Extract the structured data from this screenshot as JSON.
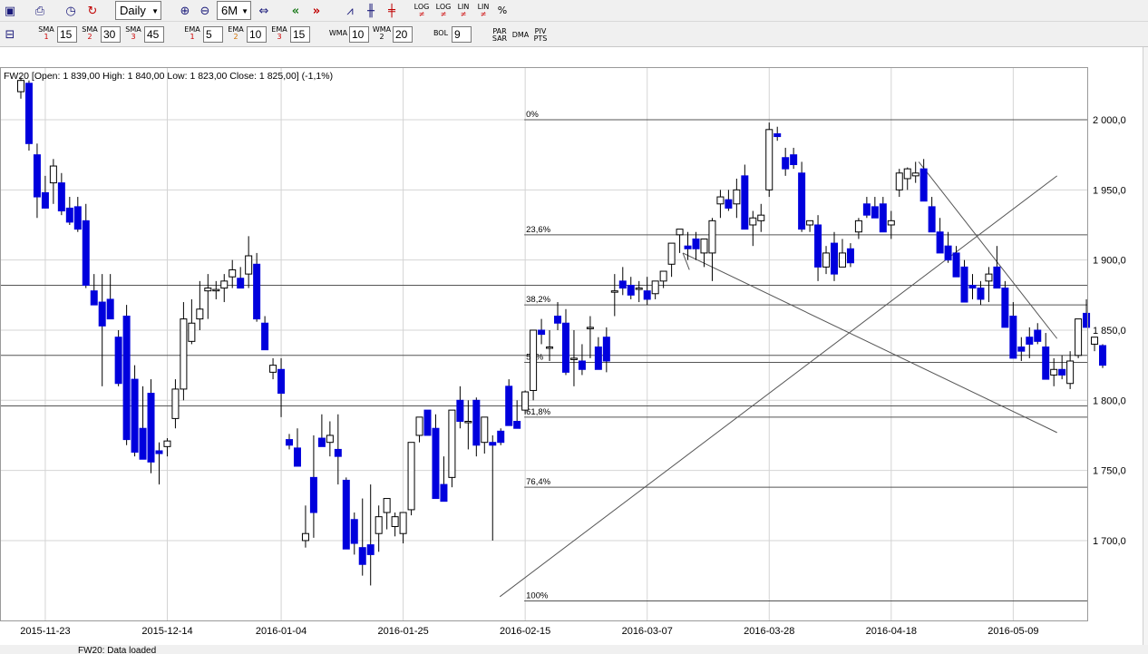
{
  "toolbar": {
    "period_select": "Daily",
    "range_select": "6M",
    "scale_buttons": [
      {
        "top": "LOG",
        "bottom": "≠"
      },
      {
        "top": "LOG",
        "bottom": "≠"
      },
      {
        "top": "LIN",
        "bottom": "≠"
      },
      {
        "top": "LIN",
        "bottom": "≠"
      },
      {
        "top": "%",
        "bottom": ""
      }
    ]
  },
  "indicators": [
    {
      "label": "SMA",
      "sub": "1",
      "value": "15"
    },
    {
      "label": "SMA",
      "sub": "2",
      "value": "30"
    },
    {
      "label": "SMA",
      "sub": "3",
      "value": "45"
    },
    {
      "label": "EMA",
      "sub": "1",
      "value": "5"
    },
    {
      "label": "EMA",
      "sub": "2",
      "value": "10"
    },
    {
      "label": "EMA",
      "sub": "3",
      "value": "15"
    },
    {
      "label": "WMA",
      "sub": "",
      "value": "10"
    },
    {
      "label": "WMA",
      "sub": "2",
      "value": "20"
    },
    {
      "label": "BOL",
      "sub": "",
      "value": "9"
    }
  ],
  "toggles": {
    "parsar": [
      "PAR",
      "SAR"
    ],
    "dma": "DMA",
    "pivpts": [
      "PIV",
      "PTS"
    ]
  },
  "status_text": "FW20: Data loaded",
  "colors": {
    "down": "#0000dd",
    "up": "#ffffff",
    "wick": "#000000",
    "grid": "#d4d4d4",
    "line": "#555555"
  },
  "chart_data": {
    "type": "candlestick",
    "title": "FW20 [Open: 1 839,00  High: 1 840,00  Low: 1 823,00  Close: 1 825,00] (-1,1%)",
    "yticks": [
      1700,
      1750,
      1800,
      1850,
      1900,
      1950,
      2000
    ],
    "ytick_labels": [
      "1 700,0",
      "1 750,0",
      "1 800,0",
      "1 850,0",
      "1 900,0",
      "1 950,0",
      "2 000,0"
    ],
    "ylim": [
      1655,
      2040
    ],
    "xtick_labels": [
      {
        "label": "2015-11-23",
        "index": 2
      },
      {
        "label": "2015-12-14",
        "index": 17
      },
      {
        "label": "2016-01-04",
        "index": 31
      },
      {
        "label": "2016-01-25",
        "index": 46
      },
      {
        "label": "2016-02-15",
        "index": 61
      },
      {
        "label": "2016-03-07",
        "index": 76
      },
      {
        "label": "2016-03-28",
        "index": 91
      },
      {
        "label": "2016-04-18",
        "index": 106
      },
      {
        "label": "2016-05-09",
        "index": 121
      }
    ],
    "candles": [
      [
        2020,
        2030,
        2015,
        2028
      ],
      [
        2026,
        2028,
        1978,
        1983
      ],
      [
        1975,
        1983,
        1930,
        1945
      ],
      [
        1948,
        1960,
        1938,
        1937
      ],
      [
        1955,
        1972,
        1940,
        1967
      ],
      [
        1955,
        1962,
        1932,
        1935
      ],
      [
        1937,
        1945,
        1925,
        1927
      ],
      [
        1938,
        1945,
        1920,
        1922
      ],
      [
        1928,
        1940,
        1880,
        1882
      ],
      [
        1878,
        1890,
        1868,
        1868
      ],
      [
        1870,
        1890,
        1810,
        1853
      ],
      [
        1872,
        1890,
        1860,
        1858
      ],
      [
        1845,
        1850,
        1810,
        1812
      ],
      [
        1860,
        1868,
        1768,
        1772
      ],
      [
        1815,
        1825,
        1760,
        1763
      ],
      [
        1780,
        1810,
        1758,
        1758
      ],
      [
        1805,
        1815,
        1748,
        1756
      ],
      [
        1764,
        1770,
        1740,
        1762
      ],
      [
        1767,
        1773,
        1760,
        1771
      ],
      [
        1787,
        1815,
        1780,
        1808
      ],
      [
        1808,
        1870,
        1800,
        1858
      ],
      [
        1842,
        1872,
        1840,
        1855
      ],
      [
        1858,
        1885,
        1850,
        1865
      ],
      [
        1878,
        1890,
        1858,
        1880
      ],
      [
        1878,
        1885,
        1872,
        1879
      ],
      [
        1880,
        1890,
        1870,
        1885
      ],
      [
        1888,
        1900,
        1880,
        1893
      ],
      [
        1887,
        1895,
        1880,
        1880
      ],
      [
        1890,
        1917,
        1880,
        1903
      ],
      [
        1897,
        1905,
        1856,
        1858
      ],
      [
        1855,
        1860,
        1836,
        1836
      ],
      [
        1820,
        1830,
        1815,
        1825
      ],
      [
        1822,
        1830,
        1788,
        1805
      ],
      [
        1772,
        1776,
        1765,
        1768
      ],
      [
        1766,
        1780,
        1755,
        1753
      ],
      [
        1700,
        1725,
        1695,
        1705
      ],
      [
        1745,
        1775,
        1702,
        1720
      ],
      [
        1773,
        1790,
        1768,
        1767
      ],
      [
        1770,
        1785,
        1760,
        1775
      ],
      [
        1765,
        1790,
        1740,
        1760
      ],
      [
        1743,
        1745,
        1698,
        1694
      ],
      [
        1715,
        1720,
        1690,
        1698
      ],
      [
        1695,
        1730,
        1675,
        1683
      ],
      [
        1697,
        1740,
        1668,
        1690
      ],
      [
        1705,
        1725,
        1692,
        1717
      ],
      [
        1720,
        1730,
        1708,
        1730
      ],
      [
        1710,
        1720,
        1703,
        1717
      ],
      [
        1705,
        1718,
        1698,
        1720
      ],
      [
        1722,
        1760,
        1718,
        1770
      ],
      [
        1775,
        1785,
        1770,
        1788
      ],
      [
        1793,
        1790,
        1780,
        1775
      ],
      [
        1780,
        1790,
        1748,
        1730
      ],
      [
        1740,
        1760,
        1730,
        1728
      ],
      [
        1745,
        1790,
        1738,
        1793
      ],
      [
        1800,
        1810,
        1780,
        1785
      ],
      [
        1785,
        1800,
        1765,
        1785
      ],
      [
        1800,
        1802,
        1760,
        1768
      ],
      [
        1770,
        1785,
        1762,
        1788
      ],
      [
        1770,
        1775,
        1700,
        1768
      ],
      [
        1778,
        1780,
        1768,
        1770
      ],
      [
        1810,
        1815,
        1782,
        1782
      ],
      [
        1785,
        1800,
        1780,
        1780
      ],
      [
        1793,
        1807,
        1790,
        1806
      ],
      [
        1807,
        1812,
        1800,
        1850
      ],
      [
        1850,
        1858,
        1840,
        1847
      ],
      [
        1838,
        1850,
        1828,
        1838
      ],
      [
        1860,
        1870,
        1850,
        1855
      ],
      [
        1855,
        1865,
        1818,
        1820
      ],
      [
        1830,
        1850,
        1810,
        1830
      ],
      [
        1828,
        1840,
        1818,
        1822
      ],
      [
        1852,
        1860,
        1830,
        1852
      ],
      [
        1838,
        1845,
        1822,
        1822
      ],
      [
        1845,
        1852,
        1820,
        1828
      ],
      [
        1878,
        1890,
        1860,
        1878
      ],
      [
        1885,
        1895,
        1875,
        1880
      ],
      [
        1882,
        1888,
        1872,
        1875
      ],
      [
        1880,
        1885,
        1870,
        1880
      ],
      [
        1878,
        1888,
        1868,
        1872
      ],
      [
        1876,
        1885,
        1872,
        1885
      ],
      [
        1885,
        1890,
        1880,
        1892
      ],
      [
        1897,
        1912,
        1888,
        1912
      ],
      [
        1918,
        1920,
        1905,
        1922
      ],
      [
        1910,
        1920,
        1900,
        1908
      ],
      [
        1915,
        1920,
        1900,
        1908
      ],
      [
        1905,
        1912,
        1895,
        1915
      ],
      [
        1905,
        1930,
        1885,
        1928
      ],
      [
        1940,
        1950,
        1930,
        1945
      ],
      [
        1943,
        1950,
        1935,
        1937
      ],
      [
        1940,
        1958,
        1930,
        1950
      ],
      [
        1960,
        1968,
        1922,
        1922
      ],
      [
        1925,
        1935,
        1910,
        1930
      ],
      [
        1928,
        1940,
        1920,
        1932
      ],
      [
        1950,
        1998,
        1945,
        1993
      ],
      [
        1990,
        1995,
        1985,
        1988
      ],
      [
        1973,
        1980,
        1960,
        1965
      ],
      [
        1975,
        1980,
        1965,
        1968
      ],
      [
        1962,
        1970,
        1920,
        1922
      ],
      [
        1925,
        1928,
        1920,
        1928
      ],
      [
        1925,
        1932,
        1885,
        1895
      ],
      [
        1895,
        1910,
        1890,
        1905
      ],
      [
        1912,
        1920,
        1885,
        1890
      ],
      [
        1895,
        1915,
        1895,
        1905
      ],
      [
        1908,
        1912,
        1895,
        1898
      ],
      [
        1920,
        1930,
        1915,
        1928
      ],
      [
        1940,
        1945,
        1930,
        1932
      ],
      [
        1938,
        1945,
        1932,
        1930
      ],
      [
        1940,
        1945,
        1920,
        1920
      ],
      [
        1925,
        1935,
        1915,
        1928
      ],
      [
        1950,
        1965,
        1945,
        1962
      ],
      [
        1958,
        1966,
        1950,
        1965
      ],
      [
        1960,
        1970,
        1955,
        1962
      ],
      [
        1965,
        1972,
        1945,
        1942
      ],
      [
        1938,
        1945,
        1920,
        1920
      ],
      [
        1920,
        1930,
        1905,
        1905
      ],
      [
        1910,
        1920,
        1898,
        1900
      ],
      [
        1905,
        1910,
        1890,
        1888
      ],
      [
        1895,
        1900,
        1875,
        1870
      ],
      [
        1882,
        1890,
        1872,
        1880
      ],
      [
        1880,
        1885,
        1868,
        1872
      ],
      [
        1885,
        1895,
        1870,
        1890
      ],
      [
        1895,
        1910,
        1880,
        1880
      ],
      [
        1880,
        1885,
        1852,
        1852
      ],
      [
        1860,
        1870,
        1830,
        1830
      ],
      [
        1838,
        1845,
        1828,
        1835
      ],
      [
        1845,
        1852,
        1830,
        1840
      ],
      [
        1850,
        1855,
        1840,
        1842
      ],
      [
        1838,
        1848,
        1815,
        1815
      ],
      [
        1818,
        1830,
        1810,
        1822
      ],
      [
        1822,
        1832,
        1815,
        1818
      ],
      [
        1812,
        1835,
        1808,
        1828
      ],
      [
        1832,
        1858,
        1830,
        1858
      ],
      [
        1862,
        1872,
        1852,
        1852
      ],
      [
        1840,
        1845,
        1835,
        1845
      ],
      [
        1839,
        1840,
        1823,
        1825
      ]
    ],
    "horizontal_levels": [
      1882,
      1832,
      1796
    ],
    "fibonacci": [
      {
        "label": "0%",
        "value": 2000
      },
      {
        "label": "23,6%",
        "value": 1918
      },
      {
        "label": "38,2%",
        "value": 1868
      },
      {
        "label": "50%",
        "value": 1827
      },
      {
        "label": "61,8%",
        "value": 1788
      },
      {
        "label": "76,4%",
        "value": 1738
      },
      {
        "label": "100%",
        "value": 1657
      }
    ],
    "trendlines": [
      {
        "from": [
          81.5,
          1905
        ],
        "to": [
          127.5,
          1777
        ]
      },
      {
        "from": [
          110.5,
          1970
        ],
        "to": [
          127.5,
          1844
        ]
      },
      {
        "from": [
          82.3,
          1893
        ],
        "to": [
          81.5,
          1905
        ]
      },
      {
        "from": [
          59,
          1660
        ],
        "to": [
          127.5,
          1960
        ]
      }
    ]
  }
}
